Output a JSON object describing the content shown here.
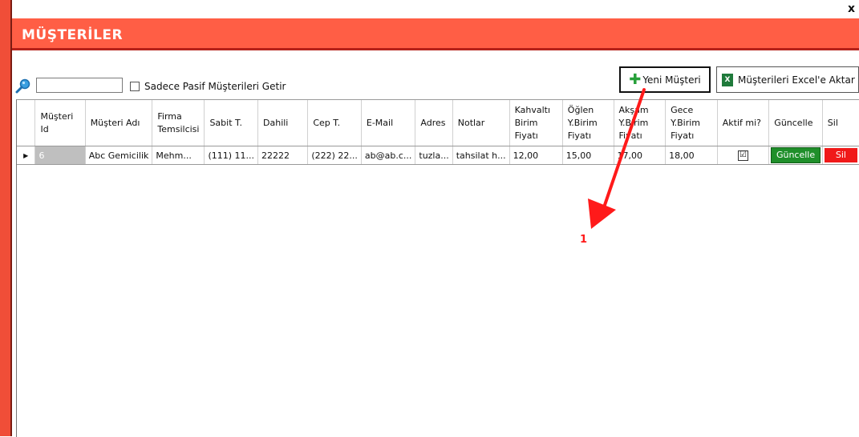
{
  "window": {
    "close_label": "x"
  },
  "header": {
    "title": "MÜŞTERİLER"
  },
  "toolbar": {
    "search_value": "",
    "passive_label": "Sadece Pasif Müşterileri Getir",
    "new_button_label": "Yeni Müşteri",
    "excel_button_label": "Müşterileri Excel'e Aktar"
  },
  "grid": {
    "columns": [
      "Müşteri Id",
      "Müşteri Adı",
      "Firma Temsilcisi",
      "Sabit T.",
      "Dahili",
      "Cep T.",
      "E-Mail",
      "Adres",
      "Notlar",
      "Kahvaltı Birim Fiyatı",
      "Öğlen Y.Birim Fiyatı",
      "Akşam Y.Birim Fiyatı",
      "Gece Y.Birim Fiyatı",
      "Aktif mi?",
      "Güncelle",
      "Sil"
    ],
    "rows": [
      {
        "id": "6",
        "name": "Abc Gemicilik",
        "rep": "Mehm...",
        "phone": "(111) 11...",
        "ext": "22222",
        "mobile": "(222) 22...",
        "email": "ab@ab.c...",
        "address": "tuzla...",
        "notes": "tahsilat h...",
        "breakfast": "12,00",
        "lunch": "15,00",
        "dinner": "17,00",
        "night": "18,00",
        "active": "☑",
        "update_label": "Güncelle",
        "delete_label": "Sil"
      }
    ]
  },
  "annotation": {
    "label": "1",
    "color": "#ff1a1a"
  },
  "colors": {
    "header": "#ff5e45",
    "accent": "#f04e38",
    "update": "#1f8f2a",
    "delete": "#f01919"
  }
}
